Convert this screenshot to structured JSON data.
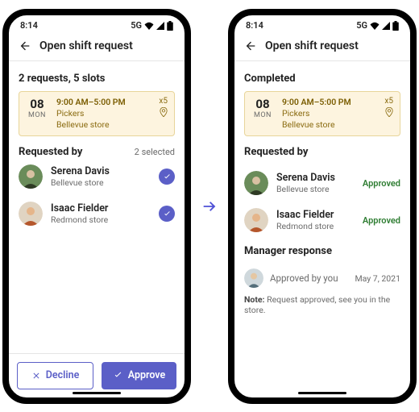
{
  "status": {
    "time": "8:14",
    "net": "5G"
  },
  "header": {
    "title": "Open shift request"
  },
  "left": {
    "summary": "2 requests, 5 slots",
    "date_num": "08",
    "date_day": "MON",
    "shift_time": "9:00 AM–5:00 PM",
    "shift_role": "Pickers",
    "shift_loc": "Bellevue store",
    "shift_qty": "x5",
    "req_label": "Requested by",
    "selected": "2 selected",
    "people": [
      {
        "name": "Serena Davis",
        "sub": "Bellevue store"
      },
      {
        "name": "Isaac Fielder",
        "sub": "Redmond store"
      }
    ],
    "decline": "Decline",
    "approve": "Approve"
  },
  "right": {
    "summary": "Completed",
    "date_num": "08",
    "date_day": "MON",
    "shift_time": "9:00 AM–5:00 PM",
    "shift_role": "Pickers",
    "shift_loc": "Bellevue store",
    "shift_qty": "x5",
    "req_label": "Requested by",
    "status_label": "Approved",
    "people": [
      {
        "name": "Serena Davis",
        "sub": "Bellevue store"
      },
      {
        "name": "Isaac Fielder",
        "sub": "Redmond store"
      }
    ],
    "mgr_section": "Manager response",
    "mgr_line": "Approved by you",
    "mgr_date": "May 7, 2021",
    "note_label": "Note:",
    "note_text": "Request approved, see you in the store."
  }
}
